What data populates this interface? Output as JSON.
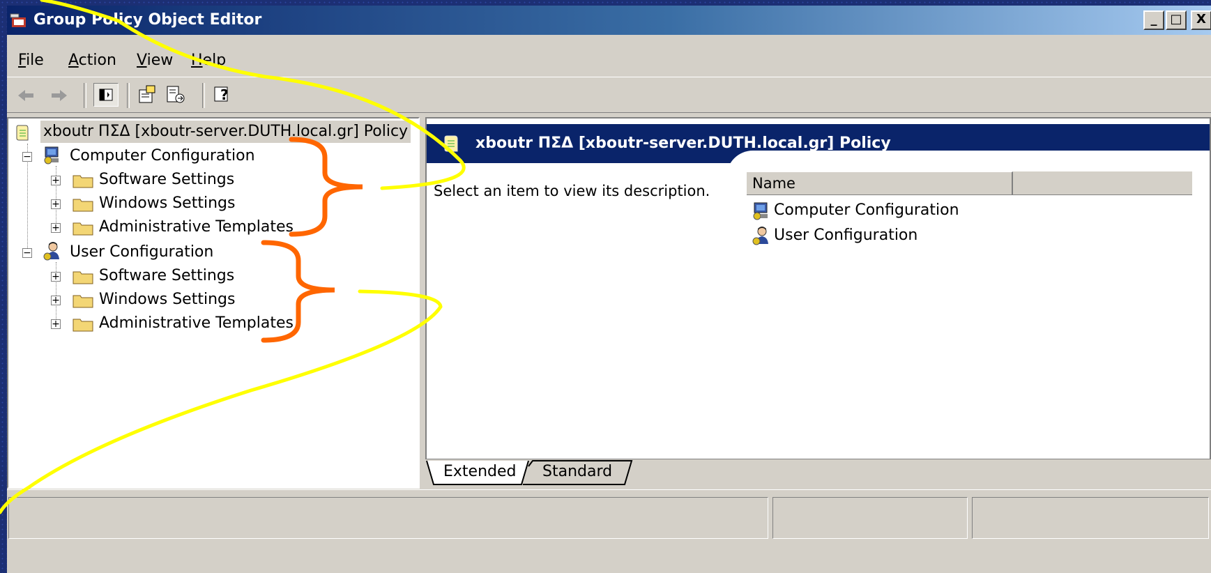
{
  "window": {
    "title": "Group Policy Object Editor",
    "controls": {
      "minimize": "_",
      "maximize": "□",
      "close": "X"
    }
  },
  "menu": [
    {
      "label": "File",
      "mnemonic": "F",
      "rest": "ile"
    },
    {
      "label": "Action",
      "mnemonic": "A",
      "rest": "ction"
    },
    {
      "label": "View",
      "mnemonic": "V",
      "rest": "iew"
    },
    {
      "label": "Help",
      "mnemonic": "H",
      "rest": "elp"
    }
  ],
  "toolbar": {
    "icons": [
      "back-arrow-icon",
      "forward-arrow-icon",
      "show-hide-tree-icon",
      "properties-icon",
      "export-list-icon",
      "help-icon"
    ]
  },
  "tree": {
    "root": "xboutr ΠΣΔ [xboutr-server.DUTH.local.gr] Policy",
    "computer": {
      "label": "Computer Configuration",
      "children": [
        "Software Settings",
        "Windows Settings",
        "Administrative Templates"
      ]
    },
    "user": {
      "label": "User Configuration",
      "children": [
        "Software Settings",
        "Windows Settings",
        "Administrative Templates"
      ]
    }
  },
  "details": {
    "header": "xboutr ΠΣΔ [xboutr-server.DUTH.local.gr] Policy",
    "description": "Select an item to view its description.",
    "column_name": "Name",
    "items": [
      "Computer Configuration",
      "User Configuration"
    ]
  },
  "tabs": [
    "Extended",
    "Standard"
  ],
  "colors": {
    "window_face": "#d4d0c8",
    "title_active": "#0a246a",
    "slide_background": "#1c2f74",
    "annotation_bracket": "#ff6600",
    "annotation_curve": "#ffff00"
  }
}
